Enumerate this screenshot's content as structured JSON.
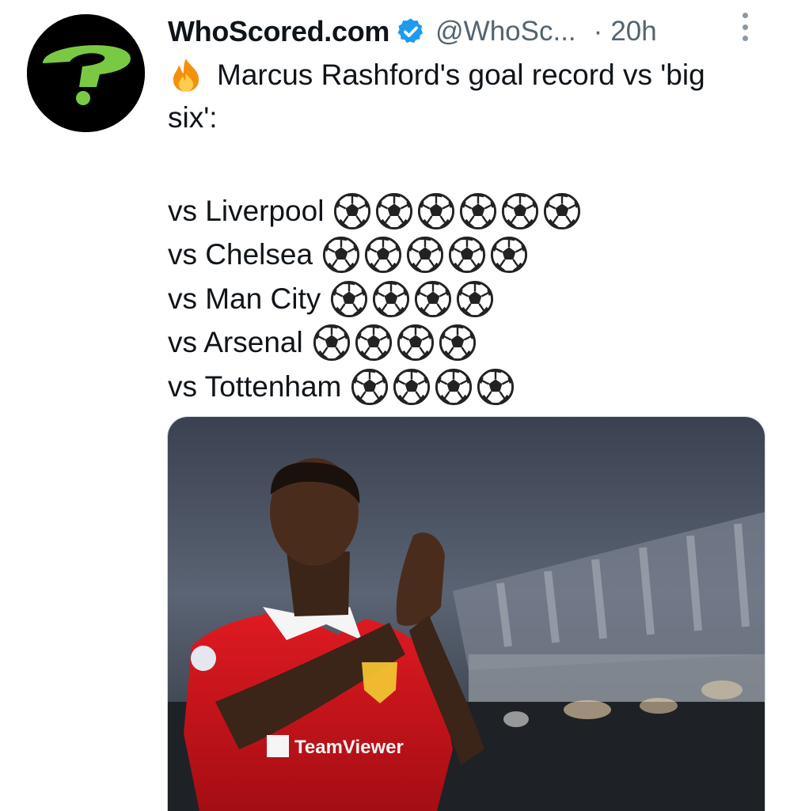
{
  "tweet": {
    "author_name": "WhoScored.com",
    "handle": "@WhoSc...",
    "separator": "·",
    "time": "20h",
    "intro_text": "Marcus Rashford's goal record vs 'big",
    "intro_text_2": "six':",
    "goal_rows": [
      {
        "label": "vs Liverpool",
        "goals": 6
      },
      {
        "label": "vs Chelsea",
        "goals": 5
      },
      {
        "label": "vs Man City",
        "goals": 4
      },
      {
        "label": "vs Arsenal",
        "goals": 4
      },
      {
        "label": "vs Tottenham",
        "goals": 4
      }
    ],
    "shirt_sponsor": "TeamViewer"
  },
  "icons": {
    "avatar": "question-mark-logo",
    "verified": "verified-badge-icon",
    "fire": "fire-emoji",
    "ball": "soccer-ball-emoji",
    "more": "more-options-icon"
  },
  "colors": {
    "verified_blue": "#1d9bf0",
    "secondary_text": "#536471",
    "logo_green": "#7ac943",
    "shirt_red": "#d7141d"
  }
}
